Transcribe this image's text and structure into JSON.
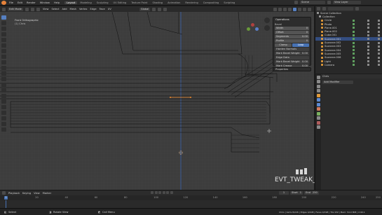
{
  "app": {
    "menu": [
      "File",
      "Edit",
      "Render",
      "Window",
      "Help"
    ],
    "workspaces": [
      "Layout",
      "Modeling",
      "Sculpting",
      "UV Editing",
      "Texture Paint",
      "Shading",
      "Animation",
      "Rendering",
      "Compositing",
      "Scripting"
    ],
    "active_workspace": "Layout",
    "scene": "Scene",
    "view_layer": "View Layer"
  },
  "viewport_header": {
    "mode": "Edit Mode",
    "menus": [
      "View",
      "Select",
      "Add",
      "Mesh",
      "Vertex",
      "Edge",
      "Face",
      "UV"
    ],
    "transform_orientation": "Global"
  },
  "viewport": {
    "view_name": "Front Orthographic",
    "collection": "(1) Chris",
    "overlay_event": "EVT_TWEAK_L"
  },
  "operator_panel": {
    "title": "Operations",
    "section": "Bevel",
    "rows": [
      {
        "label": "Width",
        "value": "0"
      },
      {
        "label": "Offset",
        "value": "0"
      },
      {
        "label": "Segments",
        "value": "0.00"
      },
      {
        "label": "Profile",
        "value": "0"
      }
    ],
    "toggles": [
      "Clamp",
      "Loop"
    ],
    "subsections": [
      {
        "label": "Harden Normals",
        "value": ""
      },
      {
        "label": "Mark Bevel Weight",
        "value": "0.00"
      },
      {
        "label": "Edge Data",
        "value": ""
      },
      {
        "label": "Mark Bevel Weight",
        "value": "0.00"
      },
      {
        "label": "Mark Crease",
        "value": "0.00"
      }
    ],
    "properties_label": "Properties"
  },
  "outliner": {
    "search_placeholder": "",
    "items": [
      {
        "label": "Scene Collection",
        "color": "#9a9a9a",
        "selected": false
      },
      {
        "label": "Collection",
        "color": "#9a9a9a",
        "selected": false
      },
      {
        "label": "Circle",
        "color": "#e09a3a",
        "selected": false
      },
      {
        "label": "Photo",
        "color": "#e09a3a",
        "selected": false
      },
      {
        "label": "Plane.001",
        "color": "#e09a3a",
        "selected": false
      },
      {
        "label": "Plane.002",
        "color": "#e09a3a",
        "selected": false
      },
      {
        "label": "Cube.001",
        "color": "#e09a3a",
        "selected": false
      },
      {
        "label": "Suzanne.001",
        "color": "#e09a3a",
        "selected": true
      },
      {
        "label": "Suzanne.002",
        "color": "#e09a3a",
        "selected": false
      },
      {
        "label": "Suzanne.003",
        "color": "#e09a3a",
        "selected": false
      },
      {
        "label": "Suzanne.004",
        "color": "#e09a3a",
        "selected": false
      },
      {
        "label": "Suzanne.005",
        "color": "#e09a3a",
        "selected": false
      },
      {
        "label": "Suzanne.006",
        "color": "#e09a3a",
        "selected": false
      },
      {
        "label": "Light",
        "color": "#e09a3a",
        "selected": false
      },
      {
        "label": "Camera",
        "color": "#e09a3a",
        "selected": false
      }
    ]
  },
  "properties": {
    "header": "Chris",
    "modifier": "Add Modifier",
    "tab_colors": [
      "#8a8a8a",
      "#8a8a8a",
      "#8a8a8a",
      "#8a8a8a",
      "#e09a3a",
      "#5d8ad0",
      "#5d8ad0",
      "#d07a5d",
      "#7ab060",
      "#8a8a8a",
      "#b05d5d",
      "#8a8a8a"
    ]
  },
  "timeline": {
    "menus": [
      "Playback",
      "Keying",
      "View",
      "Marker"
    ],
    "current_frame": "1",
    "start": "1",
    "end": "250",
    "start_label": "Start",
    "end_label": "End",
    "ticks": [
      "0",
      "20",
      "40",
      "60",
      "80",
      "100",
      "120",
      "140",
      "160",
      "180",
      "200",
      "220",
      "240",
      "250"
    ]
  },
  "statusbar": {
    "left": "Select",
    "middle": "Rotate View",
    "right": "Call Menu",
    "stats": "Chris | Verts 8/226 | Edges 4/408 | Faces 0/198 | Tris 432 | Mem: 54.0 MiB | 2.90.1"
  },
  "colors": {
    "accent": "#4772b3",
    "active_object": "#e09a3a",
    "viewport_bg": "#3d3d3d"
  }
}
